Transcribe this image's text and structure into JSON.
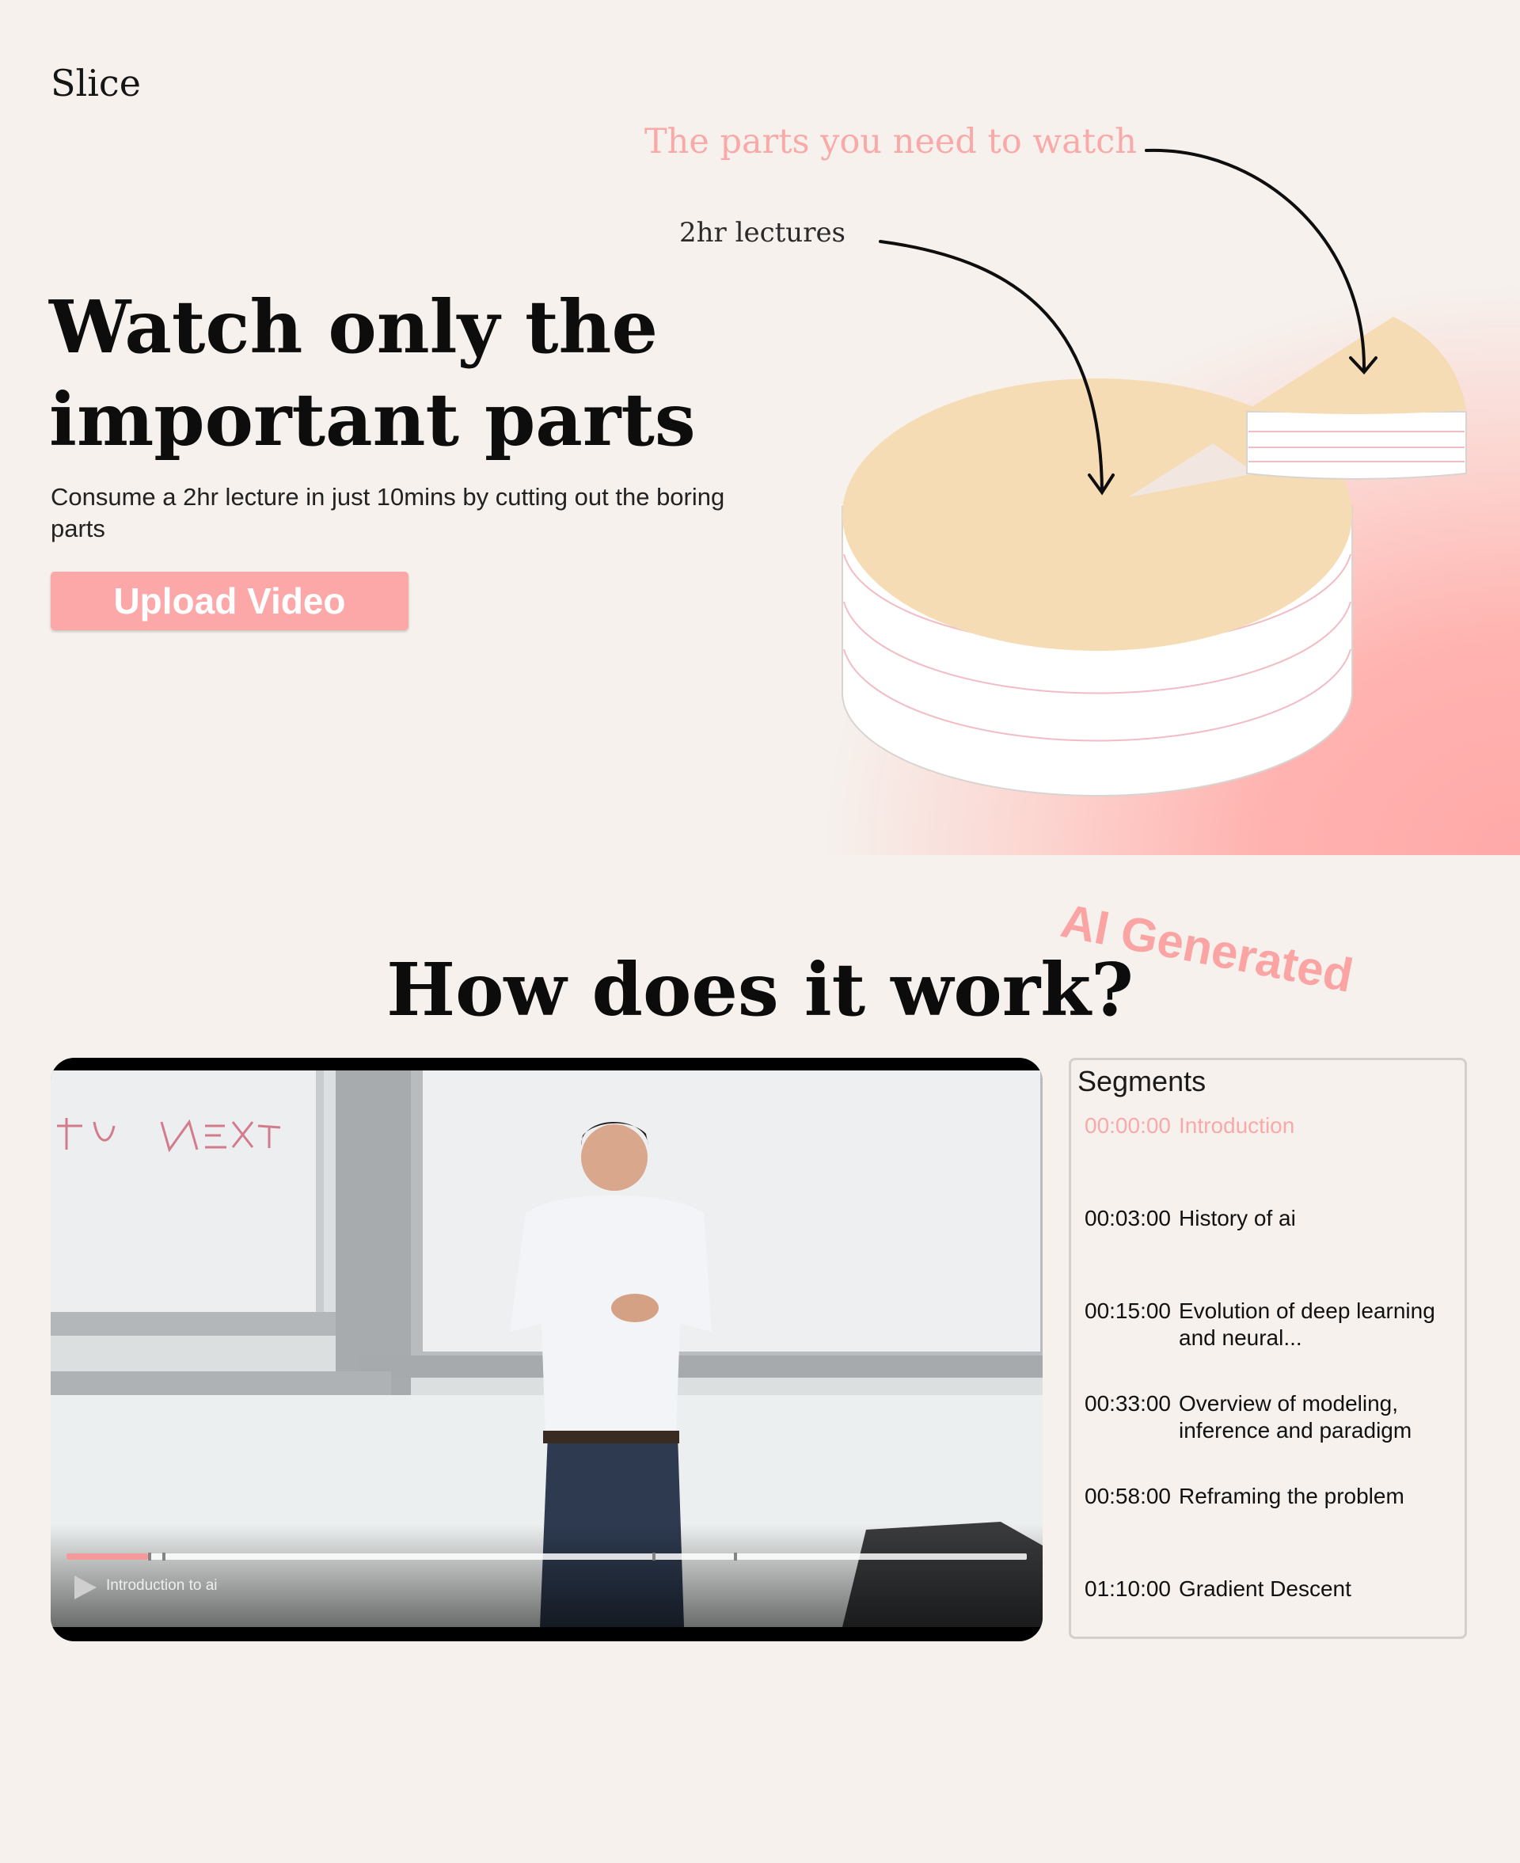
{
  "brand": {
    "logo": "Slice"
  },
  "hero": {
    "title": "Watch only the important parts",
    "subtitle": "Consume a 2hr lecture in just 10mins by cutting out the boring parts",
    "upload_label": "Upload Video",
    "annotation_parts": "The parts you need to watch",
    "annotation_lectures": "2hr lectures"
  },
  "how": {
    "title": "How does it work?",
    "ai_tag": "AI Generated"
  },
  "video": {
    "title": "Introduction to ai",
    "progress_fraction": 0.085,
    "segment_fractions": [
      0.085,
      0.1,
      0.61,
      0.695
    ]
  },
  "segments_panel": {
    "heading": "Segments",
    "items": [
      {
        "time": "00:00:00",
        "label": "Introduction"
      },
      {
        "time": "00:03:00",
        "label": "History of ai"
      },
      {
        "time": "00:15:00",
        "label": "Evolution of deep learning and neural..."
      },
      {
        "time": "00:33:00",
        "label": "Overview of modeling, inference and paradigm"
      },
      {
        "time": "00:58:00",
        "label": "Reframing the problem"
      },
      {
        "time": "01:10:00",
        "label": "Gradient Descent"
      }
    ]
  },
  "colors": {
    "accent_pink": "#fda8a8",
    "cake_top": "#f5dcb5",
    "background": "#f6f1ed"
  }
}
